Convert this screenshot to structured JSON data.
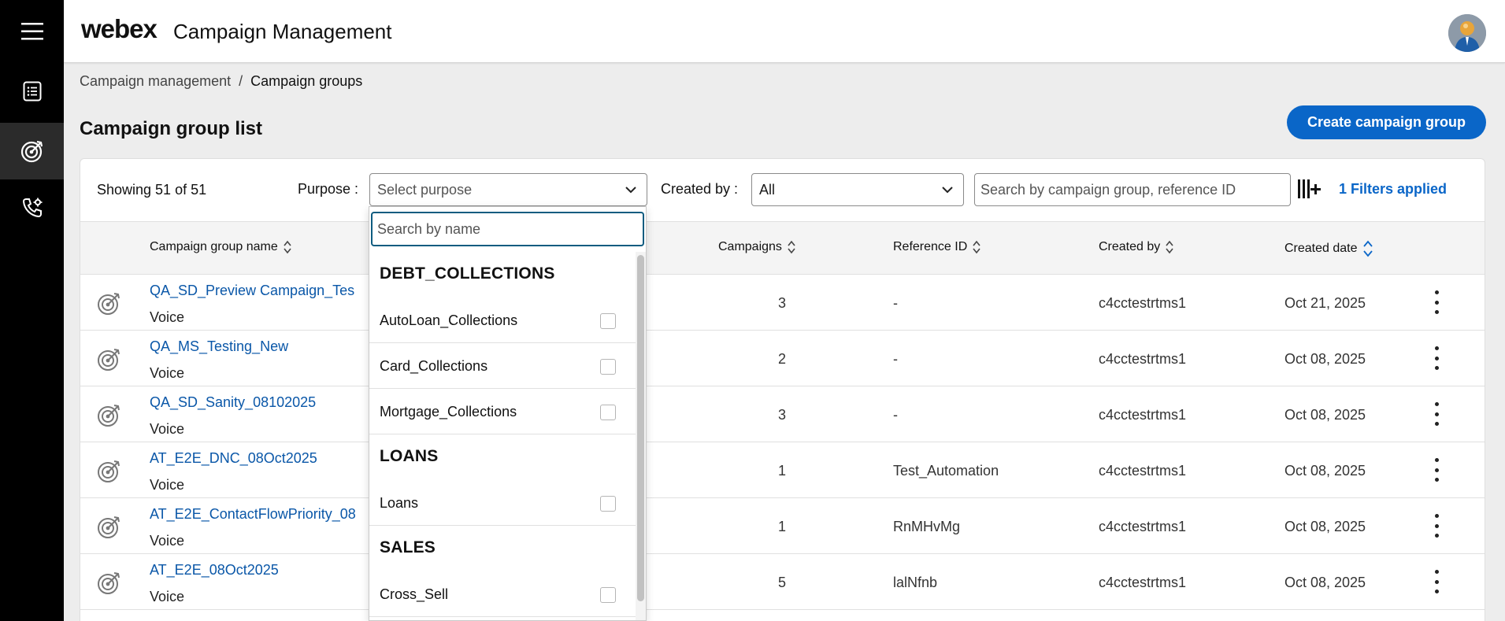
{
  "app": {
    "logo_text": "webex",
    "title": "Campaign Management"
  },
  "rail": {
    "items": [
      {
        "icon": "menu-icon"
      },
      {
        "icon": "list-doc-icon"
      },
      {
        "icon": "target-icon",
        "active": true
      },
      {
        "icon": "phone-settings-icon"
      }
    ]
  },
  "breadcrumb": {
    "parent": "Campaign management",
    "separator": "/",
    "current": "Campaign groups"
  },
  "page": {
    "title": "Campaign group list",
    "create_button": "Create campaign group"
  },
  "toolbar": {
    "showing": "Showing 51 of 51",
    "purpose_label": "Purpose :",
    "purpose_placeholder": "Select purpose",
    "created_by_label": "Created by :",
    "created_by_value": "All",
    "search_placeholder": "Search by campaign group, reference ID",
    "filters_applied": "1 Filters applied"
  },
  "table": {
    "columns": [
      "Campaign group name",
      "Campaigns",
      "Reference ID",
      "Created by",
      "Created date"
    ],
    "rows": [
      {
        "name": "QA_SD_Preview Campaign_Tes",
        "type": "Voice",
        "campaigns": "3",
        "reference_id": "-",
        "created_by": "c4cctestrtms1",
        "created_date": "Oct 21, 2025"
      },
      {
        "name": "QA_MS_Testing_New",
        "type": "Voice",
        "campaigns": "2",
        "reference_id": "-",
        "created_by": "c4cctestrtms1",
        "created_date": "Oct 08, 2025"
      },
      {
        "name": "QA_SD_Sanity_08102025",
        "type": "Voice",
        "campaigns": "3",
        "reference_id": "-",
        "created_by": "c4cctestrtms1",
        "created_date": "Oct 08, 2025"
      },
      {
        "name": "AT_E2E_DNC_08Oct2025",
        "type": "Voice",
        "campaigns": "1",
        "reference_id": "Test_Automation",
        "created_by": "c4cctestrtms1",
        "created_date": "Oct 08, 2025"
      },
      {
        "name": "AT_E2E_ContactFlowPriority_08",
        "type": "Voice",
        "campaigns": "1",
        "reference_id": "RnMHvMg",
        "created_by": "c4cctestrtms1",
        "created_date": "Oct 08, 2025"
      },
      {
        "name": "AT_E2E_08Oct2025",
        "type": "Voice",
        "campaigns": "5",
        "reference_id": "lalNfnb",
        "created_by": "c4cctestrtms1",
        "created_date": "Oct 08, 2025"
      }
    ]
  },
  "purpose_dropdown": {
    "search_placeholder": "Search by name",
    "groups": [
      {
        "label": "DEBT_COLLECTIONS",
        "items": [
          "AutoLoan_Collections",
          "Card_Collections",
          "Mortgage_Collections"
        ]
      },
      {
        "label": "LOANS",
        "items": [
          "Loans"
        ]
      },
      {
        "label": "SALES",
        "items": [
          "Cross_Sell"
        ]
      }
    ]
  },
  "colors": {
    "accent": "#0a66c8",
    "link": "#0a57a8",
    "rail": "#000000"
  }
}
